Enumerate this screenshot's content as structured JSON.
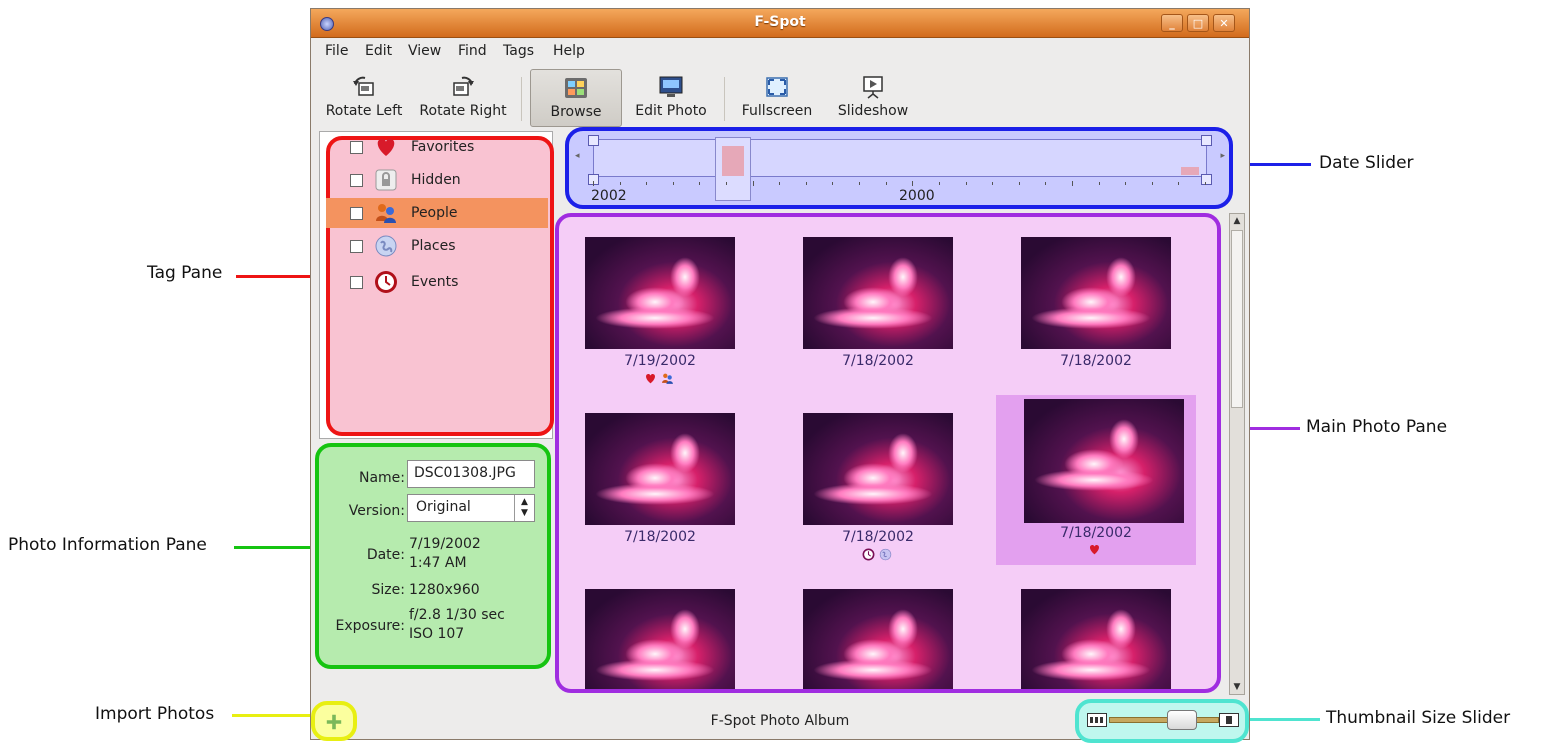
{
  "window": {
    "title": "F-Spot"
  },
  "menubar": [
    "File",
    "Edit",
    "View",
    "Find",
    "Tags",
    "Help"
  ],
  "toolbar": {
    "rotate_left": "Rotate Left",
    "rotate_right": "Rotate Right",
    "browse": "Browse",
    "edit_photo": "Edit Photo",
    "fullscreen": "Fullscreen",
    "slideshow": "Slideshow"
  },
  "tags": [
    {
      "label": "Favorites",
      "icon": "heart-icon",
      "checked": false
    },
    {
      "label": "Hidden",
      "icon": "lock-icon",
      "checked": false
    },
    {
      "label": "People",
      "icon": "people-icon",
      "checked": false,
      "selected": true
    },
    {
      "label": "Places",
      "icon": "globe-icon",
      "checked": false
    },
    {
      "label": "Events",
      "icon": "clock-icon",
      "checked": false
    }
  ],
  "info": {
    "name_label": "Name:",
    "name_value": "DSC01308.JPG",
    "version_label": "Version:",
    "version_value": "Original",
    "date_label": "Date:",
    "date_line1": "7/19/2002",
    "date_line2": "1:47 AM",
    "size_label": "Size:",
    "size_value": "1280x960",
    "exposure_label": "Exposure:",
    "exposure_line1": "f/2.8 1/30 sec",
    "exposure_line2": "ISO 107"
  },
  "date_slider": {
    "year_left": "2002",
    "year_right": "2000"
  },
  "photos": [
    {
      "date": "7/19/2002",
      "emblems": [
        "heart-icon",
        "people-icon"
      ],
      "selected": false
    },
    {
      "date": "7/18/2002",
      "emblems": [],
      "selected": false
    },
    {
      "date": "7/18/2002",
      "emblems": [],
      "selected": false
    },
    {
      "date": "7/18/2002",
      "emblems": [],
      "selected": false
    },
    {
      "date": "7/18/2002",
      "emblems": [
        "clock-icon",
        "globe-icon"
      ],
      "selected": false
    },
    {
      "date": "7/18/2002",
      "emblems": [
        "heart-icon"
      ],
      "selected": true
    },
    {
      "date": "",
      "emblems": [],
      "selected": false
    },
    {
      "date": "",
      "emblems": [],
      "selected": false
    },
    {
      "date": "",
      "emblems": [],
      "selected": false
    }
  ],
  "statusbar": {
    "text": "F-Spot Photo Album",
    "import_icon": "plus-icon"
  },
  "callouts": {
    "date_slider": "Date Slider",
    "tag_pane": "Tag Pane",
    "main_photo_pane": "Main Photo Pane",
    "photo_information_pane": "Photo Information Pane",
    "import_photos": "Import Photos",
    "thumbnail_size_slider": "Thumbnail Size Slider"
  },
  "colors": {
    "tag_pane": "#ee1414",
    "info_pane": "#16c411",
    "date_slider": "#1c20e8",
    "photo_pane": "#a02de0",
    "import": "#e8ef12",
    "size_slider": "#4fe4d0",
    "titlebar": "#e07a2c"
  }
}
